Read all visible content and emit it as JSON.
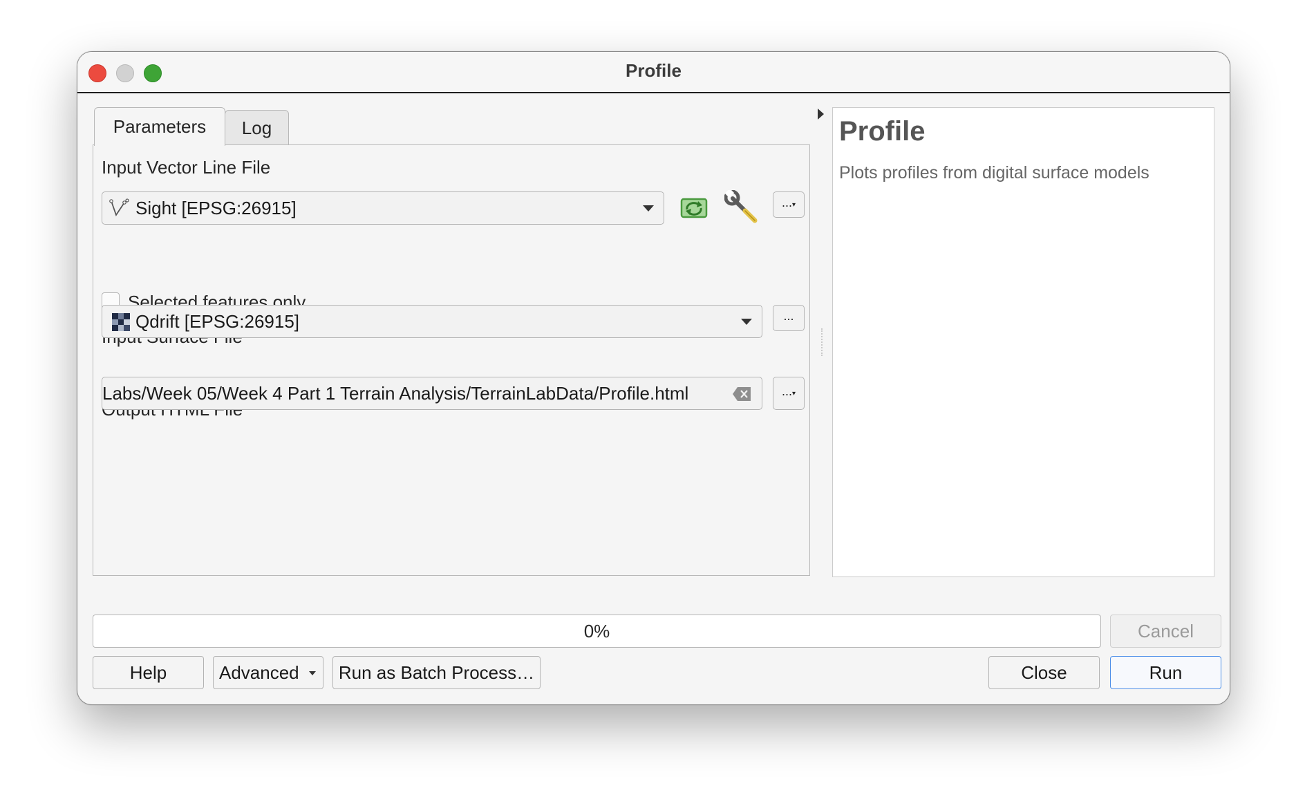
{
  "window": {
    "title": "Profile"
  },
  "tabs": [
    {
      "label": "Parameters",
      "active": true
    },
    {
      "label": "Log",
      "active": false
    }
  ],
  "params": {
    "vector_label": "Input Vector Line File",
    "vector_value": "Sight [EPSG:26915]",
    "selected_only_label": "Selected features only",
    "selected_only_checked": false,
    "surface_label": "Input Surface File",
    "surface_value": "Qdrift [EPSG:26915]",
    "output_label": "Output HTML File",
    "output_value": "Labs/Week 05/Week 4 Part 1 Terrain Analysis/TerrainLabData/Profile.html",
    "browse_label": "..."
  },
  "help": {
    "title": "Profile",
    "description": "Plots profiles from digital surface models"
  },
  "progress": {
    "text": "0%",
    "value": 0
  },
  "buttons": {
    "cancel": "Cancel",
    "help": "Help",
    "advanced": "Advanced",
    "batch": "Run as Batch Process…",
    "close": "Close",
    "run": "Run"
  },
  "colors": {
    "close_light": "#ec4b3f",
    "minimize_light": "#d2d2d2",
    "zoom_light": "#3ea436",
    "run_border": "#4c8ee8",
    "iterate_icon": "#4caf50"
  },
  "icons": {
    "vector": "line-layer-icon",
    "surface": "raster-layer-icon",
    "iterate": "iterate-icon",
    "settings": "wrench-icon",
    "clear": "clear-text-icon"
  }
}
